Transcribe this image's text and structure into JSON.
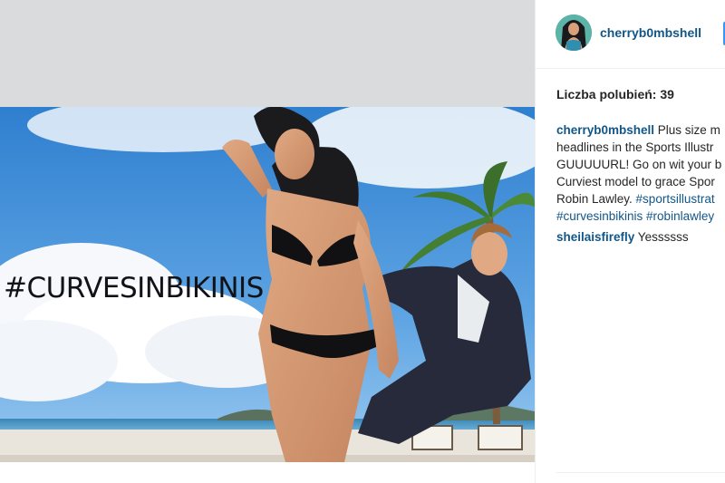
{
  "post": {
    "image_overlay_text": "#CURVESINBIKINIS"
  },
  "header": {
    "username": "cherryb0mbshell"
  },
  "likes": {
    "text": "Liczba polubień: 39"
  },
  "caption": {
    "username": "cherryb0mbshell",
    "line1_text": " Plus size m",
    "line2_text": "headlines in the Sports Illustr",
    "line3_text": "GUUUUURL! Go on wit your b",
    "line4_text": "Curviest model to grace Spor",
    "line5_text": "Robin Lawley. ",
    "line5_tag": "#sportsillustrat",
    "line6_tag1": "#curvesinbikinis",
    "line6_tag2": " #robinlawley"
  },
  "comment": {
    "username": "sheilaisfirefly",
    "text": " Yessssss"
  },
  "colors": {
    "link_blue": "#125688",
    "follow_blue": "#3897f0",
    "text_dark": "#262626",
    "gap_grey": "#dadbdd"
  }
}
